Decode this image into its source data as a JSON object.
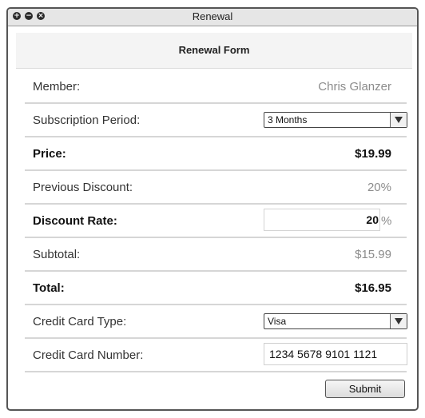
{
  "window": {
    "title": "Renewal"
  },
  "form": {
    "title": "Renewal Form",
    "member": {
      "label": "Member:",
      "value": "Chris Glanzer"
    },
    "subscription": {
      "label": "Subscription Period:",
      "selected": "3 Months"
    },
    "price": {
      "label": "Price:",
      "value": "$19.99"
    },
    "previous_discount": {
      "label": "Previous Discount:",
      "value": "20%"
    },
    "discount_rate": {
      "label": "Discount Rate:",
      "value": "20",
      "unit": "%"
    },
    "subtotal": {
      "label": "Subtotal:",
      "value": "$15.99"
    },
    "total": {
      "label": "Total:",
      "value": "$16.95"
    },
    "card_type": {
      "label": "Credit Card Type:",
      "selected": "Visa"
    },
    "card_number": {
      "label": "Credit Card Number:",
      "value": "1234 5678 9101 1121"
    },
    "submit_label": "Submit"
  },
  "icons": {
    "window_controls": [
      "add-icon",
      "minimize-icon",
      "close-icon"
    ]
  }
}
